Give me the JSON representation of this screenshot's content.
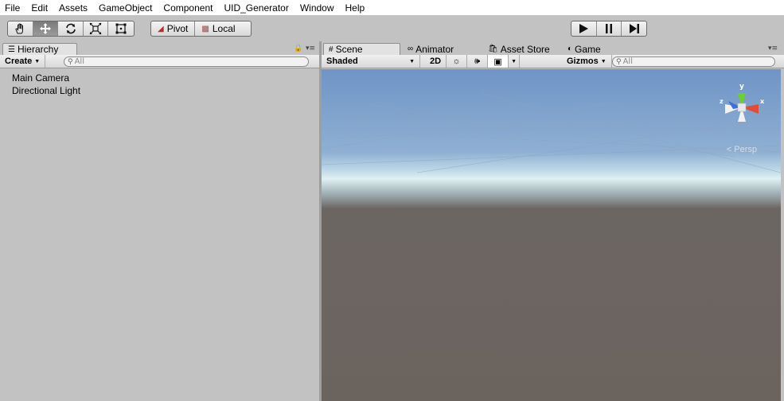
{
  "menubar": {
    "items": [
      "File",
      "Edit",
      "Assets",
      "GameObject",
      "Component",
      "UID_Generator",
      "Window",
      "Help"
    ]
  },
  "toolbar": {
    "transform_tools": [
      {
        "name": "hand-tool",
        "icon": "hand-icon",
        "active": false
      },
      {
        "name": "move-tool",
        "icon": "move-icon",
        "active": true
      },
      {
        "name": "rotate-tool",
        "icon": "rotate-icon",
        "active": false
      },
      {
        "name": "scale-tool",
        "icon": "scale-icon",
        "active": false
      },
      {
        "name": "rect-tool",
        "icon": "rect-tool-icon",
        "active": false
      }
    ],
    "pivot_label": "Pivot",
    "local_label": "Local",
    "play_icon": "play-icon",
    "pause_icon": "pause-icon",
    "step_icon": "step-icon"
  },
  "hierarchy": {
    "tab_label": "Hierarchy",
    "create_label": "Create",
    "search_placeholder": "All",
    "items": [
      "Main Camera",
      "Directional Light"
    ]
  },
  "scene": {
    "tabs": {
      "scene": "Scene",
      "animator": "Animator",
      "asset_store": "Asset Store",
      "game": "Game"
    },
    "shading_mode": "Shaded",
    "mode_2d": "2D",
    "gizmos_label": "Gizmos",
    "search_placeholder": "All",
    "gizmo_axes": {
      "y": "y",
      "x": "x",
      "z": "z"
    },
    "projection_label": "Persp"
  },
  "colors": {
    "panel_bg": "#c2c2c2",
    "sky_top": "#6f94c6",
    "horizon": "#dff0f3",
    "ground": "#6b635e",
    "gizmo_y": "#6fd02b",
    "gizmo_x": "#e04b3a",
    "gizmo_z": "#3f6fd8"
  }
}
